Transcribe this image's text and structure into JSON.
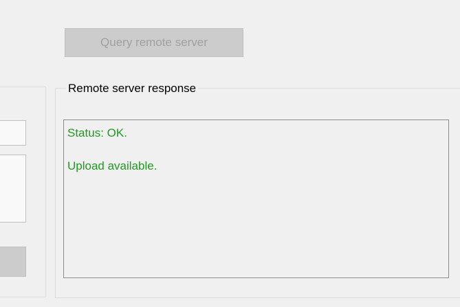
{
  "toolbar": {
    "query_button_label": "Query remote server",
    "query_button_enabled": false
  },
  "response": {
    "group_title": "Remote server response",
    "text_color": "#1f9a1f",
    "lines": [
      "Status: OK.",
      "Upload available."
    ]
  }
}
